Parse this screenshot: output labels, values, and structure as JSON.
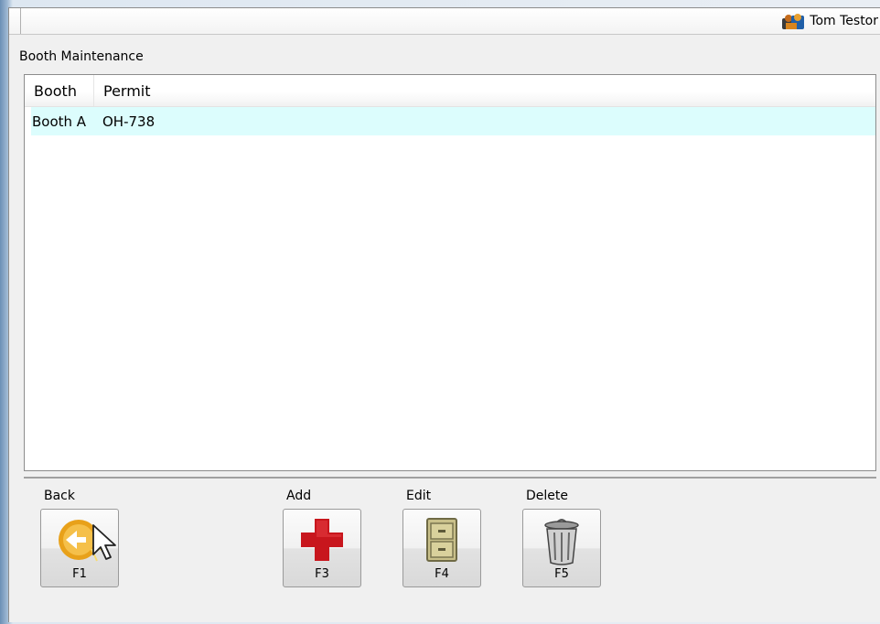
{
  "header": {
    "user_name": "Tom Testor"
  },
  "page": {
    "section_title": "Booth Maintenance"
  },
  "table": {
    "columns": [
      "Booth",
      "Permit"
    ],
    "rows": [
      {
        "booth": "Booth A",
        "permit": "OH-738"
      }
    ]
  },
  "toolbar": {
    "back": {
      "label": "Back",
      "key": "F1",
      "icon": "back-arrow-icon"
    },
    "add": {
      "label": "Add",
      "key": "F3",
      "icon": "red-cross-icon"
    },
    "edit": {
      "label": "Edit",
      "key": "F4",
      "icon": "file-cabinet-icon"
    },
    "delete": {
      "label": "Delete",
      "key": "F5",
      "icon": "trash-can-icon"
    }
  },
  "colors": {
    "selected_row": "#dcfdfd",
    "add_icon": "#c8161d",
    "back_icon": "#f0a81c"
  }
}
